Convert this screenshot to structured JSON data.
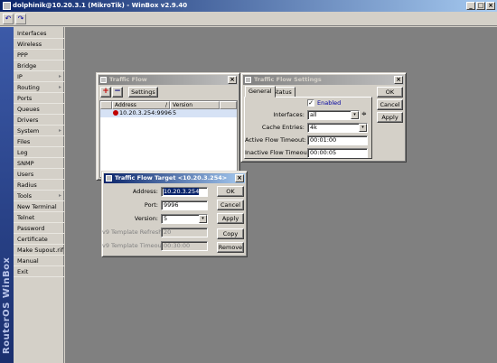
{
  "window": {
    "title": "dolphinik@10.20.3.1 (MikroTik) - WinBox v2.9.40",
    "min": "_",
    "max": "□",
    "close": "×"
  },
  "toolbar": {
    "undo": "↶",
    "redo": "↷"
  },
  "brand": "RouterOS WinBox",
  "menu": [
    {
      "label": "Interfaces",
      "arrow": ""
    },
    {
      "label": "Wireless",
      "arrow": ""
    },
    {
      "label": "PPP",
      "arrow": ""
    },
    {
      "label": "Bridge",
      "arrow": ""
    },
    {
      "label": "IP",
      "arrow": "▸"
    },
    {
      "label": "Routing",
      "arrow": "▸"
    },
    {
      "label": "Ports",
      "arrow": ""
    },
    {
      "label": "Queues",
      "arrow": ""
    },
    {
      "label": "Drivers",
      "arrow": ""
    },
    {
      "label": "System",
      "arrow": "▸"
    },
    {
      "label": "Files",
      "arrow": ""
    },
    {
      "label": "Log",
      "arrow": ""
    },
    {
      "label": "SNMP",
      "arrow": ""
    },
    {
      "label": "Users",
      "arrow": ""
    },
    {
      "label": "Radius",
      "arrow": ""
    },
    {
      "label": "Tools",
      "arrow": "▸"
    },
    {
      "label": "New Terminal",
      "arrow": ""
    },
    {
      "label": "Telnet",
      "arrow": ""
    },
    {
      "label": "Password",
      "arrow": ""
    },
    {
      "label": "Certificate",
      "arrow": ""
    },
    {
      "label": "Make Supout.rif",
      "arrow": ""
    },
    {
      "label": "Manual",
      "arrow": ""
    },
    {
      "label": "Exit",
      "arrow": ""
    }
  ],
  "traffic_flow": {
    "title": "Traffic Flow",
    "add": "+",
    "remove": "−",
    "settings_button": "Settings",
    "col_address": "Address",
    "col_sort": "/",
    "col_version": "Version",
    "row": {
      "address": "10.20.3.254:9996",
      "version": "5"
    }
  },
  "settings": {
    "title": "Traffic Flow Settings",
    "tab_general": "General",
    "tab_status": "Status",
    "enabled_label": "Enabled",
    "enabled_mark": "✓",
    "interfaces_label": "Interfaces:",
    "interfaces_value": "all",
    "cache_label": "Cache Entries:",
    "cache_value": "4k",
    "active_label": "Active Flow Timeout:",
    "active_value": "00:01:00",
    "inactive_label": "Inactive Flow Timeout:",
    "inactive_value": "00:00:05",
    "ok": "OK",
    "cancel": "Cancel",
    "apply": "Apply",
    "updown": "≑"
  },
  "target": {
    "title": "Traffic Flow Target <10.20.3.254>",
    "address_label": "Address:",
    "address_value": "10.20.3.254",
    "port_label": "Port:",
    "port_value": "9996",
    "version_label": "Version:",
    "version_value": "5",
    "refresh_label": "v9 Template Refresh:",
    "refresh_value": "20",
    "timeout_label": "v9 Template Timeout:",
    "timeout_value": "00:30:00",
    "ok": "OK",
    "cancel": "Cancel",
    "apply": "Apply",
    "copy": "Copy",
    "remove": "Remove"
  },
  "dd": "▾"
}
